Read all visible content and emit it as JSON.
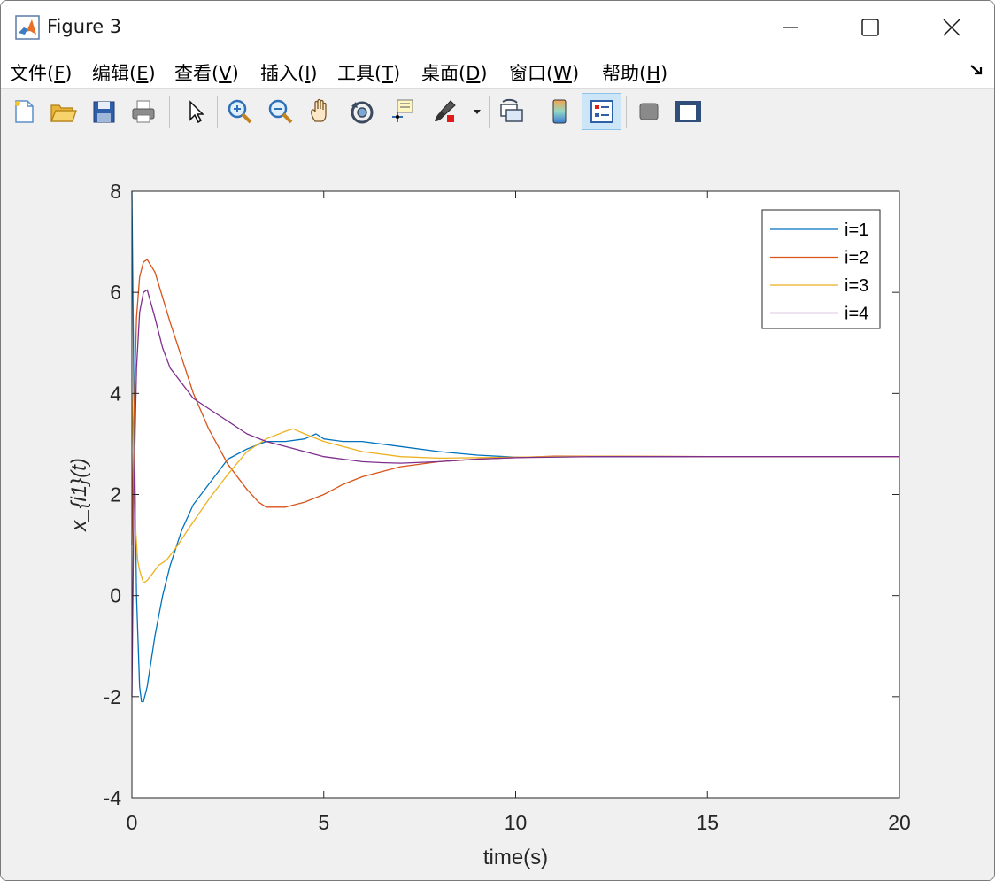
{
  "window": {
    "title": "Figure 3",
    "controls": {
      "minimize": "minimize",
      "maximize": "maximize",
      "close": "close"
    }
  },
  "menu": [
    {
      "label": "文件(",
      "key": "F",
      "end": ")"
    },
    {
      "label": "编辑(",
      "key": "E",
      "end": ")"
    },
    {
      "label": "查看(",
      "key": "V",
      "end": ")"
    },
    {
      "label": "插入(",
      "key": "I",
      "end": ")"
    },
    {
      "label": "工具(",
      "key": "T",
      "end": ")"
    },
    {
      "label": "桌面(",
      "key": "D",
      "end": ")"
    },
    {
      "label": "窗口(",
      "key": "W",
      "end": ")"
    },
    {
      "label": "帮助(",
      "key": "H",
      "end": ")"
    }
  ],
  "toolbar": {
    "buttons": [
      {
        "name": "new-figure-icon"
      },
      {
        "name": "open-file-icon"
      },
      {
        "name": "save-icon"
      },
      {
        "name": "print-icon"
      },
      {
        "name": "edit-plot-arrow-icon"
      },
      {
        "name": "zoom-in-icon"
      },
      {
        "name": "zoom-out-icon"
      },
      {
        "name": "pan-hand-icon"
      },
      {
        "name": "rotate-3d-icon"
      },
      {
        "name": "data-cursor-icon"
      },
      {
        "name": "brush-icon"
      },
      {
        "name": "link-plot-icon"
      },
      {
        "name": "colorbar-icon"
      },
      {
        "name": "legend-icon",
        "active": true
      },
      {
        "name": "hide-plot-tools-icon"
      },
      {
        "name": "show-plot-tools-icon"
      }
    ]
  },
  "chart_data": {
    "type": "line",
    "title": "",
    "xlabel": "time(s)",
    "ylabel": "x_{i1}(t)",
    "xlim": [
      0,
      20
    ],
    "ylim": [
      -4,
      8
    ],
    "xticks": [
      "0",
      "5",
      "10",
      "15",
      "20"
    ],
    "yticks": [
      "-4",
      "-2",
      "0",
      "2",
      "4",
      "6",
      "8"
    ],
    "grid": false,
    "legend_position": "top-right",
    "series": [
      {
        "name": "i=1",
        "color": "#0072BD",
        "x": [
          0,
          0.05,
          0.12,
          0.2,
          0.25,
          0.3,
          0.4,
          0.6,
          0.8,
          1.0,
          1.3,
          1.6,
          2.0,
          2.5,
          3.0,
          3.5,
          4.0,
          4.5,
          4.8,
          5.0,
          5.5,
          6.0,
          7.0,
          8.0,
          9.0,
          10.0,
          12.0,
          15.0,
          20.0
        ],
        "y": [
          8.0,
          4.0,
          0.0,
          -1.8,
          -2.1,
          -2.1,
          -1.8,
          -0.8,
          0.0,
          0.6,
          1.3,
          1.8,
          2.2,
          2.7,
          2.9,
          3.05,
          3.05,
          3.1,
          3.2,
          3.1,
          3.05,
          3.05,
          2.95,
          2.85,
          2.78,
          2.74,
          2.75,
          2.75,
          2.75
        ]
      },
      {
        "name": "i=2",
        "color": "#D95319",
        "x": [
          0,
          0.05,
          0.12,
          0.2,
          0.3,
          0.4,
          0.6,
          0.8,
          1.0,
          1.3,
          1.6,
          2.0,
          2.5,
          3.0,
          3.3,
          3.5,
          4.0,
          4.5,
          5.0,
          5.5,
          6.0,
          7.0,
          8.0,
          9.0,
          10.0,
          11.0,
          12.0,
          15.0,
          20.0
        ],
        "y": [
          1.0,
          3.5,
          5.5,
          6.3,
          6.6,
          6.65,
          6.4,
          5.9,
          5.4,
          4.7,
          4.0,
          3.3,
          2.6,
          2.1,
          1.85,
          1.75,
          1.75,
          1.85,
          2.0,
          2.2,
          2.35,
          2.55,
          2.65,
          2.7,
          2.73,
          2.76,
          2.76,
          2.75,
          2.75
        ]
      },
      {
        "name": "i=3",
        "color": "#EDB120",
        "x": [
          0,
          0.05,
          0.1,
          0.15,
          0.2,
          0.3,
          0.4,
          0.5,
          0.7,
          0.9,
          1.2,
          1.5,
          2.0,
          2.5,
          3.0,
          3.5,
          4.0,
          4.2,
          4.5,
          5.0,
          6.0,
          7.0,
          8.0,
          10.0,
          12.0,
          15.0,
          20.0
        ],
        "y": [
          4.0,
          2.5,
          1.3,
          0.7,
          0.5,
          0.25,
          0.3,
          0.4,
          0.6,
          0.7,
          1.0,
          1.35,
          1.9,
          2.4,
          2.85,
          3.1,
          3.25,
          3.3,
          3.2,
          3.05,
          2.85,
          2.75,
          2.72,
          2.74,
          2.76,
          2.75,
          2.75
        ]
      },
      {
        "name": "i=4",
        "color": "#7E2F8E",
        "x": [
          0,
          0.05,
          0.12,
          0.2,
          0.3,
          0.4,
          0.6,
          0.8,
          1.0,
          1.3,
          1.6,
          2.0,
          2.5,
          3.0,
          3.5,
          4.0,
          4.5,
          5.0,
          5.5,
          6.0,
          6.5,
          7.0,
          8.0,
          9.0,
          10.0,
          12.0,
          15.0,
          20.0
        ],
        "y": [
          -2.0,
          2.0,
          4.5,
          5.6,
          6.0,
          6.05,
          5.5,
          4.9,
          4.5,
          4.2,
          3.9,
          3.7,
          3.45,
          3.2,
          3.05,
          2.95,
          2.85,
          2.75,
          2.7,
          2.65,
          2.63,
          2.62,
          2.65,
          2.7,
          2.73,
          2.75,
          2.75,
          2.75
        ]
      }
    ]
  }
}
